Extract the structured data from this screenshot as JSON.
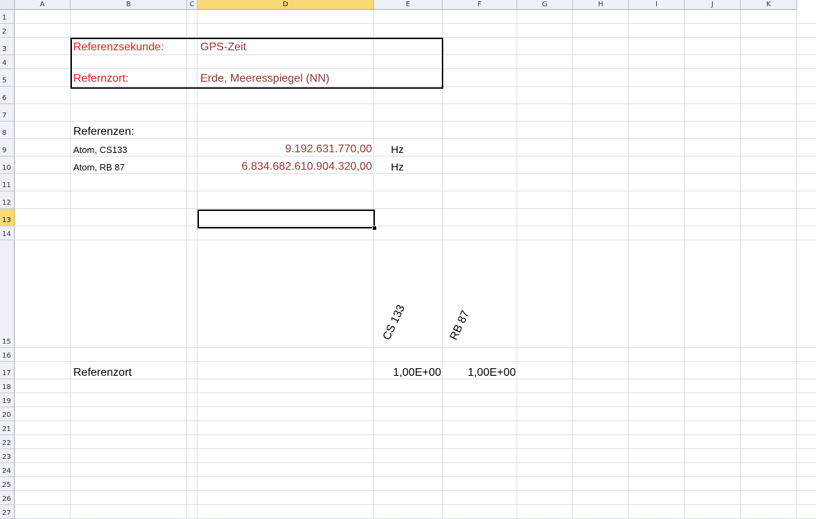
{
  "columns": [
    "A",
    "B",
    "C",
    "D",
    "E",
    "F",
    "G",
    "H",
    "I",
    "J",
    "K"
  ],
  "selected_column": "D",
  "rows": [
    "1",
    "2",
    "3",
    "4",
    "5",
    "6",
    "7",
    "8",
    "9",
    "10",
    "11",
    "12",
    "13",
    "14",
    "15",
    "16",
    "17",
    "18",
    "19",
    "20",
    "21",
    "22",
    "23",
    "24",
    "25",
    "26",
    "27"
  ],
  "selected_row": "13",
  "cells": {
    "B3": "Referenzsekunde:",
    "D3": "GPS-Zeit",
    "B5": "Refernzort:",
    "D5": "Erde, Meeresspiegel (NN)",
    "B8": "Referenzen:",
    "B9": "Atom, CS133",
    "D9": "9.192.631.770,00",
    "E9": "Hz",
    "B10": "Atom, RB 87",
    "D10": "6.834.682.610.904.320,00",
    "E10": "Hz",
    "E15": "CS 133",
    "F15": "RB 87",
    "B17": "Referenzort",
    "E17": "1,00E+00",
    "F17": "1,00E+00"
  },
  "colors": {
    "label_red": "#e31b1b",
    "value_brown": "#953735",
    "text_black": "#000000",
    "header_selected": "#f7d976"
  }
}
